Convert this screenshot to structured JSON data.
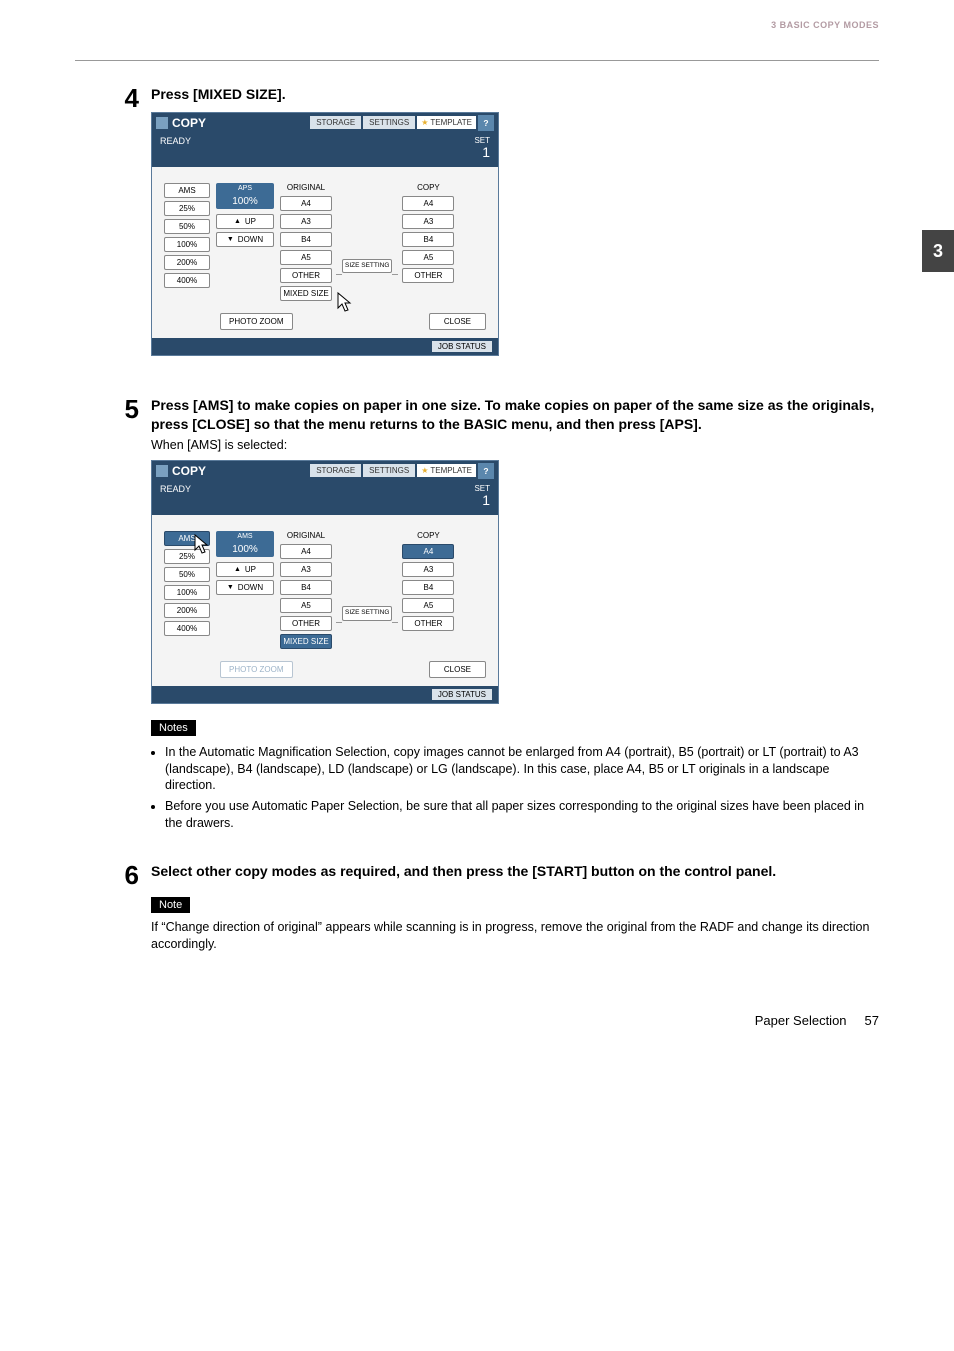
{
  "header": {
    "section": "3 BASIC COPY MODES"
  },
  "side_tab": "3",
  "steps": {
    "s4": {
      "num": "4",
      "title": "Press [MIXED SIZE]."
    },
    "s5": {
      "num": "5",
      "title": "Press [AMS] to make copies on paper in one size. To make copies on paper of the same size as the originals, press [CLOSE] so that the menu returns to the BASIC menu, and then press [APS].",
      "sub": "When [AMS] is selected:"
    },
    "s6": {
      "num": "6",
      "title": "Select other copy modes as required, and then press the [START] button on the control panel."
    }
  },
  "copy_panel": {
    "title": "COPY",
    "top_buttons": {
      "storage": "STORAGE",
      "settings": "SETTINGS",
      "template": "TEMPLATE"
    },
    "help": "?",
    "status": "READY",
    "set_label": "SET",
    "set_num": "1",
    "col_zoom_btns": [
      "AMS",
      "25%",
      "50%",
      "100%",
      "200%",
      "400%"
    ],
    "aps_label": "APS",
    "zoom_display": "100%",
    "up": "UP",
    "down": "DOWN",
    "original_hdr": "ORIGINAL",
    "copy_hdr": "COPY",
    "sizes": [
      "A4",
      "A3",
      "B4",
      "A5",
      "OTHER"
    ],
    "mixed_size": "MIXED SIZE",
    "size_setting": "SIZE SETTING",
    "photo_zoom": "PHOTO ZOOM",
    "close": "CLOSE",
    "job_status": "JOB STATUS"
  },
  "notes": {
    "label_plural": "Notes",
    "label_single": "Note",
    "list": [
      "In the Automatic Magnification Selection, copy images cannot be enlarged from A4 (portrait), B5 (portrait) or LT (portrait) to A3 (landscape), B4 (landscape), LD (landscape) or LG (landscape). In this case, place A4, B5 or LT originals in a landscape direction.",
      "Before you use Automatic Paper Selection, be sure that all paper sizes corresponding to the original sizes have been placed in the drawers."
    ],
    "single_text": "If “Change direction of original” appears while scanning is in progress, remove the original from the RADF and change its direction accordingly."
  },
  "footer": {
    "label": "Paper Selection",
    "page": "57"
  }
}
